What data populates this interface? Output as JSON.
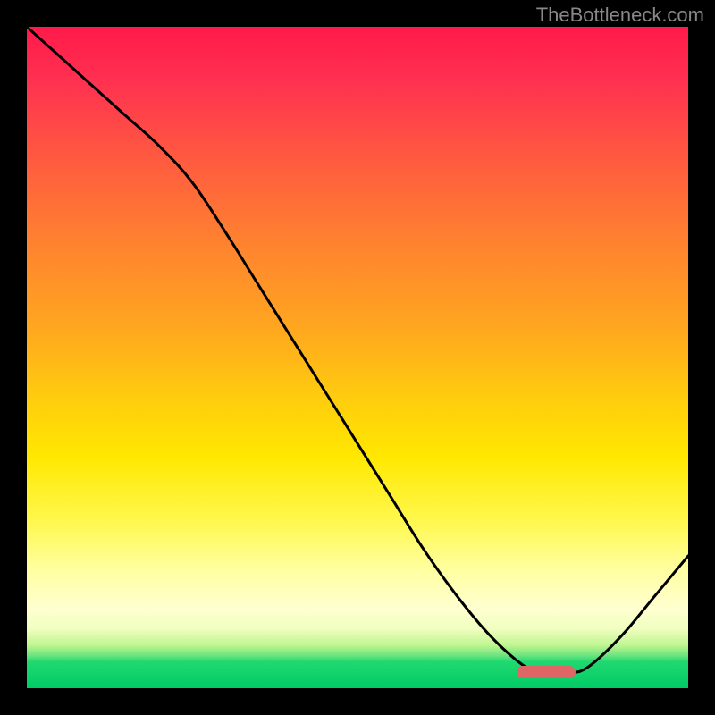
{
  "watermark": "TheBottleneck.com",
  "chart_data": {
    "type": "line",
    "title": "",
    "xlabel": "",
    "ylabel": "",
    "xlim": [
      0,
      100
    ],
    "ylim": [
      0,
      100
    ],
    "x": [
      0,
      5,
      10,
      15,
      20,
      25,
      30,
      35,
      40,
      45,
      50,
      55,
      60,
      65,
      70,
      75,
      78,
      82,
      85,
      90,
      95,
      100
    ],
    "values": [
      100,
      95.5,
      91,
      86.5,
      82,
      76.5,
      69,
      61,
      53,
      45,
      37,
      29,
      21,
      14,
      8,
      3.5,
      2.3,
      2.3,
      3.3,
      8,
      14,
      20
    ],
    "marker": {
      "x_start": 74,
      "x_end": 83,
      "y": 2.4
    },
    "gradient_stops": [
      {
        "pos": 0,
        "color": "#ff1a4a"
      },
      {
        "pos": 50,
        "color": "#ffd400"
      },
      {
        "pos": 88,
        "color": "#ffffd0"
      },
      {
        "pos": 100,
        "color": "#00cc66"
      }
    ]
  }
}
